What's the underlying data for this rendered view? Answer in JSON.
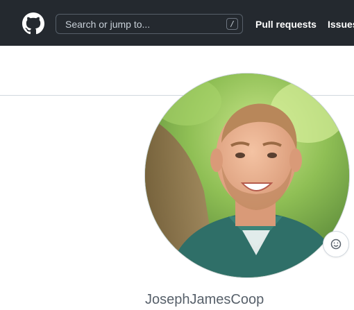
{
  "header": {
    "logo_icon": "github-mark-icon",
    "search": {
      "placeholder": "Search or jump to...",
      "shortcut_key": "/"
    },
    "nav": {
      "pull_requests": "Pull requests",
      "issues": "Issues"
    }
  },
  "profile": {
    "avatar_icon": "user-avatar",
    "status_icon": "smiley-icon",
    "username": "JosephJamesCoop"
  },
  "colors": {
    "header_bg": "#24292f",
    "divider": "#d0d7de",
    "username_text": "#57606a"
  }
}
